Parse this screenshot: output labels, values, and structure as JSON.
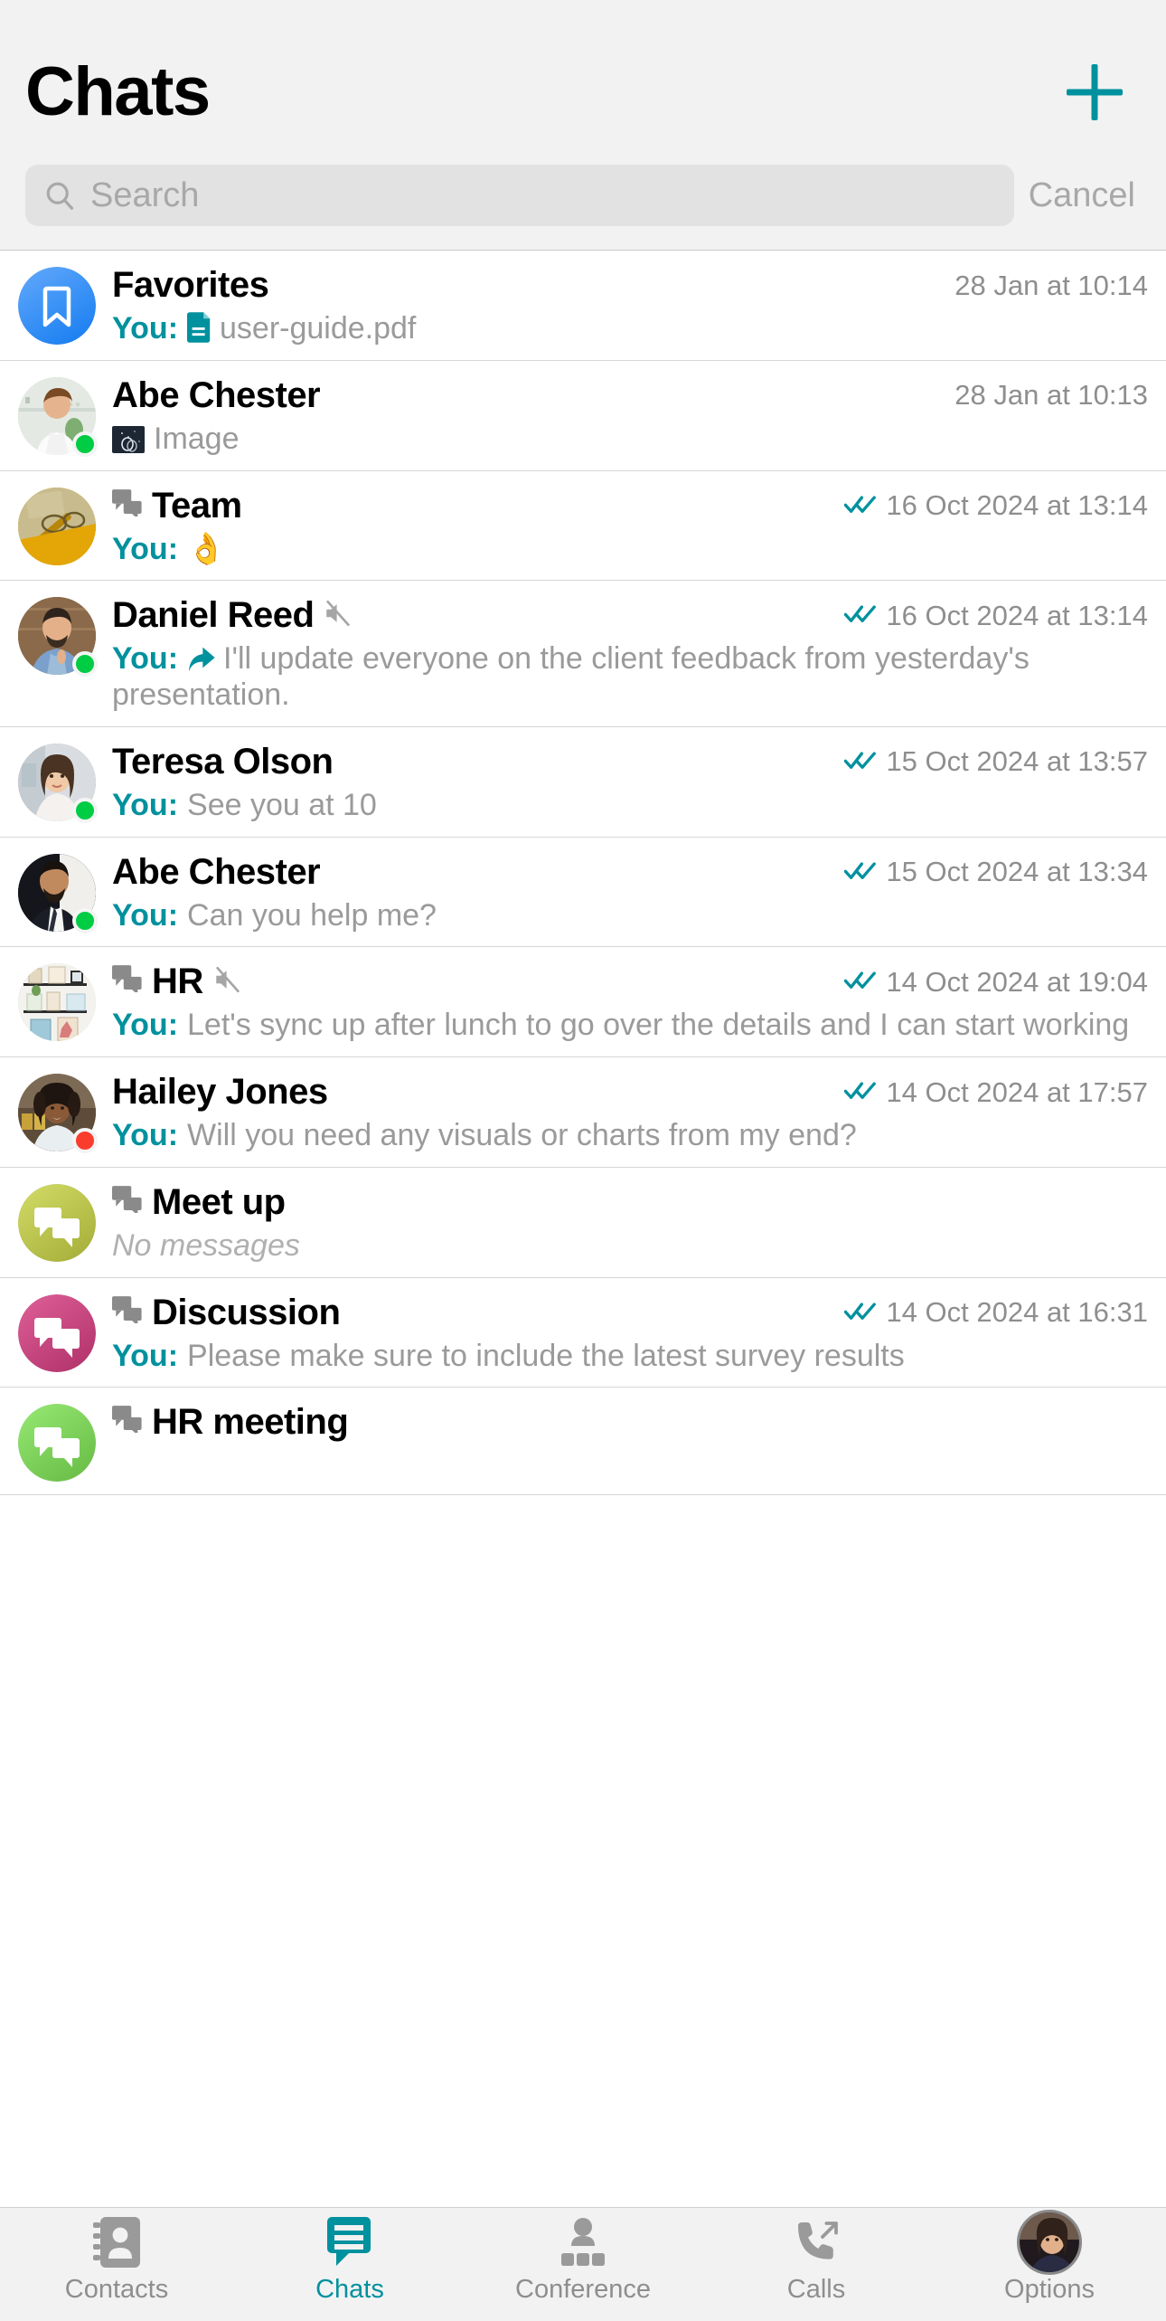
{
  "header": {
    "title": "Chats",
    "add_button": "+",
    "add_icon": "plus-icon"
  },
  "search": {
    "placeholder": "Search",
    "value": "",
    "cancel_label": "Cancel",
    "icon": "search-icon"
  },
  "colors": {
    "accent": "#00919e",
    "title": "#000000",
    "secondary_text": "#9a9a9a",
    "timestamp": "#8e8e8e",
    "online": "#00cc44",
    "busy": "#fa3c2d",
    "header_bg": "#f2f2f2",
    "search_bg": "#e2e2e2",
    "row_bg": "#ffffff",
    "separator": "#d6d6d6"
  },
  "chats": [
    {
      "name": "Favorites",
      "timestamp": "28 Jan at 10:14",
      "you_prefix": "You:",
      "preview": "user-guide.pdf",
      "read_receipt": false,
      "is_group": false,
      "muted": false,
      "presence": "none",
      "avatar_kind": "bookmark",
      "avatar_color": "#3b8ef7",
      "attachment_icon": "document-icon"
    },
    {
      "name": "Abe Chester",
      "timestamp": "28 Jan at 10:13",
      "you_prefix": "",
      "preview": "Image",
      "read_receipt": false,
      "is_group": false,
      "muted": false,
      "presence": "online",
      "avatar_kind": "photo-man-1",
      "avatar_color": "#cfd7d2",
      "attachment_icon": "image-thumbnail-icon"
    },
    {
      "name": "Team",
      "timestamp": "16 Oct 2024 at 13:14",
      "you_prefix": "You:",
      "preview": "👌",
      "read_receipt": true,
      "is_group": true,
      "muted": false,
      "presence": "none",
      "avatar_kind": "photo-desk",
      "avatar_color": "#e0a800",
      "attachment_icon": ""
    },
    {
      "name": "Daniel Reed",
      "timestamp": "16 Oct 2024 at 13:14",
      "you_prefix": "You:",
      "preview": "I'll update everyone on the client feedback from yesterday's presentation.",
      "read_receipt": true,
      "is_group": false,
      "muted": true,
      "presence": "online",
      "avatar_kind": "photo-man-2",
      "avatar_color": "#8a6a4f",
      "attachment_icon": "forward-icon"
    },
    {
      "name": "Teresa Olson",
      "timestamp": "15 Oct 2024 at 13:57",
      "you_prefix": "You:",
      "preview": "See you at 10",
      "read_receipt": true,
      "is_group": false,
      "muted": false,
      "presence": "online",
      "avatar_kind": "photo-woman-1",
      "avatar_color": "#b9a392",
      "attachment_icon": ""
    },
    {
      "name": "Abe Chester",
      "timestamp": "15 Oct 2024 at 13:34",
      "you_prefix": "You:",
      "preview": "Can you help me?",
      "read_receipt": true,
      "is_group": false,
      "muted": false,
      "presence": "online",
      "avatar_kind": "photo-man-3",
      "avatar_color": "#2b2b33",
      "attachment_icon": ""
    },
    {
      "name": "HR",
      "timestamp": "14 Oct 2024 at 19:04",
      "you_prefix": "You:",
      "preview": "Let's sync up after lunch to go over the details and I can start working",
      "read_receipt": true,
      "is_group": true,
      "muted": true,
      "presence": "none",
      "avatar_kind": "photo-wall",
      "avatar_color": "#dfe5da",
      "attachment_icon": ""
    },
    {
      "name": "Hailey Jones",
      "timestamp": "14 Oct 2024 at 17:57",
      "you_prefix": "You:",
      "preview": "Will you need any visuals or charts from my end?",
      "read_receipt": true,
      "is_group": false,
      "muted": false,
      "presence": "busy",
      "avatar_kind": "photo-woman-2",
      "avatar_color": "#a98a6b",
      "attachment_icon": ""
    },
    {
      "name": "Meet up",
      "timestamp": "",
      "you_prefix": "",
      "preview": "No messages",
      "read_receipt": false,
      "is_group": true,
      "muted": false,
      "presence": "none",
      "avatar_kind": "group-bubbles",
      "avatar_color": "#a8b23c",
      "attachment_icon": ""
    },
    {
      "name": "Discussion",
      "timestamp": "14 Oct 2024 at 16:31",
      "you_prefix": "You:",
      "preview": "Please make sure to include the latest survey results",
      "read_receipt": true,
      "is_group": true,
      "muted": false,
      "presence": "none",
      "avatar_kind": "group-bubbles",
      "avatar_color": "#b5366e",
      "attachment_icon": ""
    },
    {
      "name": "HR meeting",
      "timestamp": "",
      "you_prefix": "",
      "preview": "",
      "read_receipt": false,
      "is_group": true,
      "muted": false,
      "presence": "none",
      "avatar_kind": "group-bubbles",
      "avatar_color": "#6cc04a",
      "attachment_icon": ""
    }
  ],
  "tabbar": {
    "items": [
      {
        "label": "Contacts",
        "icon": "contacts-icon",
        "active": false
      },
      {
        "label": "Chats",
        "icon": "chats-icon",
        "active": true
      },
      {
        "label": "Conference",
        "icon": "conference-icon",
        "active": false
      },
      {
        "label": "Calls",
        "icon": "calls-icon",
        "active": false
      },
      {
        "label": "Options",
        "icon": "profile-avatar",
        "active": false
      }
    ]
  }
}
